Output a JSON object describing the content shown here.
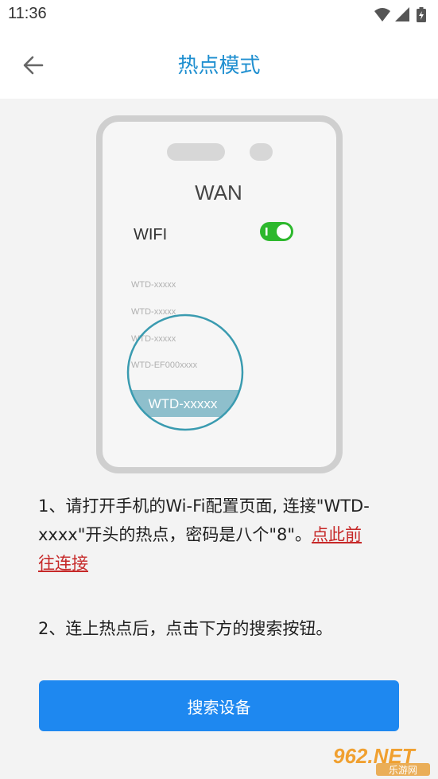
{
  "status_bar": {
    "time": "11:36",
    "icons": [
      "wifi-icon",
      "signal-icon",
      "battery-icon"
    ]
  },
  "app_bar": {
    "back_icon": "arrow-left-icon",
    "title": "热点模式"
  },
  "illustration": {
    "header": "WAN",
    "wifi_label": "WIFI",
    "wifi_toggle_on": true,
    "networks": [
      "WTD-xxxxx",
      "WTD-xxxxx",
      "WTD-xxxxx",
      "WTD-EF000xxxx"
    ],
    "highlighted_network": "WTD-xxxxx"
  },
  "instructions": {
    "step1_text": "1、请打开手机的Wi-Fi配置页面, 连接\"WTD-xxxx\"开头的热点，密码是八个\"8\"。",
    "step1_link": "点此前往连接",
    "step2_text": "2、连上热点后，点击下方的搜索按钮。"
  },
  "search_button": {
    "label": "搜索设备"
  },
  "watermark": {
    "logo_text": "962.NET",
    "sub_text": "乐游网"
  },
  "colors": {
    "accent": "#1f8fd0",
    "button": "#1e88f0",
    "link": "#c62828",
    "toggle": "#2db82d",
    "circle": "#3a9bb0"
  }
}
